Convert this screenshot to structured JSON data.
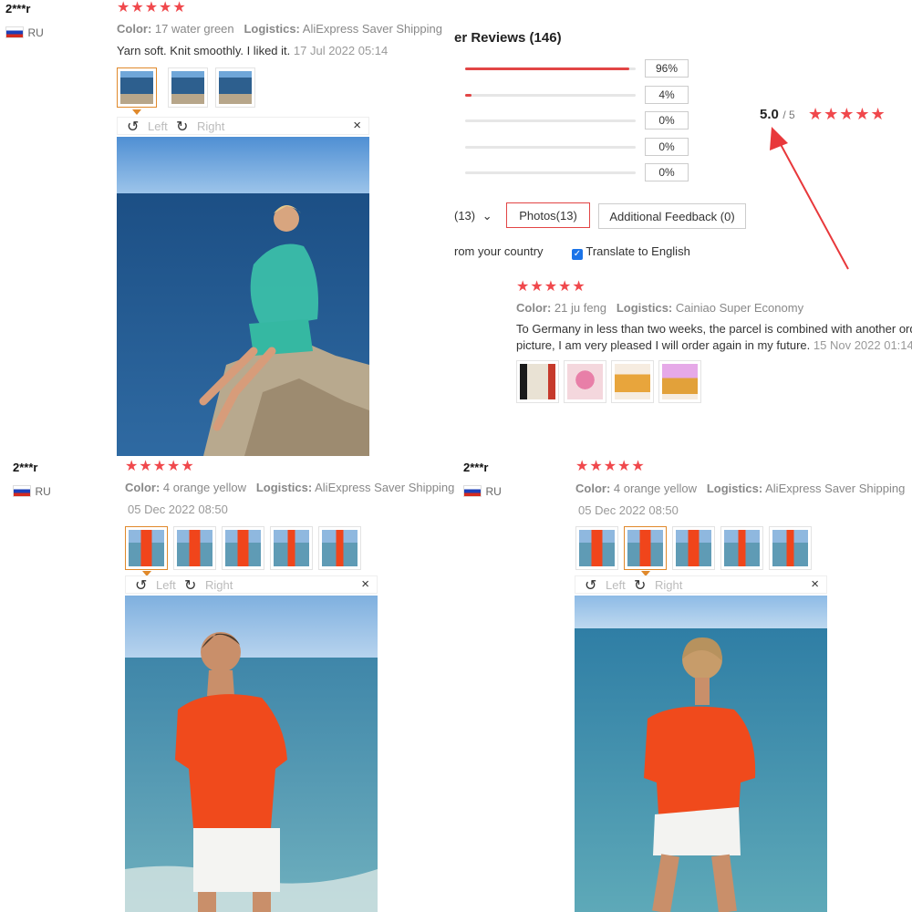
{
  "summary": {
    "title": "er Reviews (146)",
    "score": "5.0",
    "score_of": "/ 5",
    "stars": "★★★★★",
    "bars": [
      {
        "label": "96%",
        "fill": 0.96
      },
      {
        "label": "4%",
        "fill": 0.04
      },
      {
        "label": "0%",
        "fill": 0
      },
      {
        "label": "0%",
        "fill": 0
      },
      {
        "label": "0%",
        "fill": 0
      }
    ],
    "filters": {
      "partial": "(13)",
      "chevron": "⌄",
      "photos": "Photos(13)",
      "additional": "Additional Feedback (0)"
    },
    "country_partial": "rom your country",
    "translate": "Translate to English",
    "translate_checked": true
  },
  "review_top_left": {
    "user": "2***r",
    "country": "RU",
    "stars": "★★★★★",
    "color_label": "Color:",
    "color": "17 water green",
    "logistics_label": "Logistics:",
    "logistics": "AliExpress Saver Shipping",
    "text": "Yarn soft. Knit smoothly. I liked it.",
    "date": "17 Jul 2022 05:14",
    "toolbar": {
      "left": "Left",
      "right": "Right",
      "close": "×"
    }
  },
  "review_middle": {
    "stars": "★★★★★",
    "color_label": "Color:",
    "color": "21 ju feng",
    "logistics_label": "Logistics:",
    "logistics": "Cainiao Super Economy",
    "text1": "To Germany in less than two weeks, the parcel is combined with another ord",
    "text2": "picture, I am very pleased I will order again in my future.",
    "date": "15 Nov 2022 01:14"
  },
  "review_bottom_left": {
    "user": "2***r",
    "country": "RU",
    "stars": "★★★★★",
    "color_label": "Color:",
    "color": "4 orange yellow",
    "logistics_label": "Logistics:",
    "logistics": "AliExpress Saver Shipping",
    "date": "05 Dec 2022 08:50",
    "toolbar": {
      "left": "Left",
      "right": "Right",
      "close": "×"
    }
  },
  "review_bottom_right": {
    "user": "2***r",
    "country": "RU",
    "stars": "★★★★★",
    "color_label": "Color:",
    "color": "4 orange yellow",
    "logistics_label": "Logistics:",
    "logistics": "AliExpress Saver Shipping",
    "date": "05 Dec 2022 08:50",
    "toolbar": {
      "left": "Left",
      "right": "Right",
      "close": "×"
    }
  },
  "colors": {
    "accent": "#f0484c",
    "selected_border": "#e0892b",
    "annotation_arrow": "#e8383b"
  }
}
